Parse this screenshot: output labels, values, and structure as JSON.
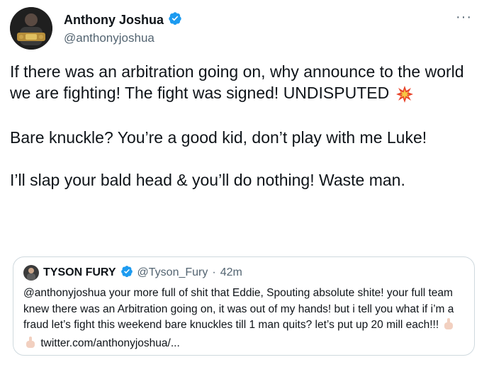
{
  "tweet": {
    "author_name": "Anthony Joshua",
    "author_handle": "@anthonyjoshua",
    "more_label": "···",
    "paragraphs": [
      "If there was an arbitration going on, why announce to the world we are fighting! The fight was signed! UNDISPUTED",
      "Bare knuckle? You’re a good kid, don’t play with me Luke!",
      "I’ll slap your bald head & you’ll do nothing! Waste man."
    ],
    "emoji_after_p1": "collision-emoji"
  },
  "quoted": {
    "author_name": "TYSON FURY",
    "author_handle": "@Tyson_Fury",
    "separator": "·",
    "time": "42m",
    "text_before_emoji": "@anthonyjoshua your more full of shit that Eddie, Spouting absolute shite! your full team knew there was an Arbitration going on, it was out of my hands! but i tell you what if i’m a fraud let’s fight this weekend bare knuckles till 1 man quits? let’s put up 20 mill each!!!",
    "link": "twitter.com/anthonyjoshua/..."
  },
  "colors": {
    "verified": "#1d9bf0",
    "text": "#0f1419",
    "secondary": "#536471",
    "border": "#cfd9de"
  }
}
